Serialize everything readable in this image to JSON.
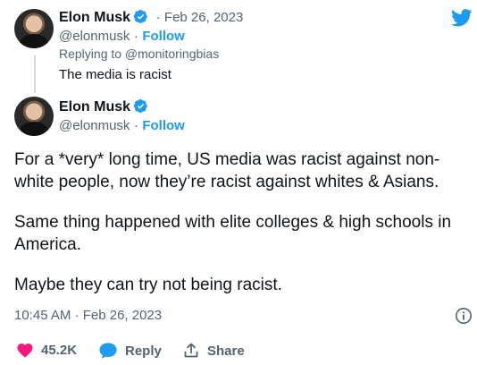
{
  "quoted": {
    "name": "Elon Musk",
    "handle": "@elonmusk",
    "separator": "·",
    "date": "Feb 26, 2023",
    "follow_label": "Follow",
    "replying_to": "Replying to @monitoringbias",
    "text": "The media is racist"
  },
  "tweet": {
    "name": "Elon Musk",
    "handle": "@elonmusk",
    "separator": "·",
    "follow_label": "Follow",
    "lines": [
      "For a *very* long time, US media was racist against non-",
      "white people, now they’re racist against whites & Asians.",
      "",
      "Same thing happened with elite colleges & high schools in",
      "America.",
      "",
      "Maybe they can try not being racist."
    ],
    "timestamp": "10:45 AM · Feb 26, 2023"
  },
  "footer": {
    "likes": "45.2K",
    "reply_label": "Reply",
    "share_label": "Share"
  },
  "colors": {
    "brand": "#1d9bf0",
    "like": "#f91880",
    "muted": "#536471"
  },
  "icons": [
    "twitter-bird-icon",
    "verified-badge-icon",
    "info-icon",
    "heart-icon",
    "reply-bubble-icon",
    "share-icon"
  ]
}
